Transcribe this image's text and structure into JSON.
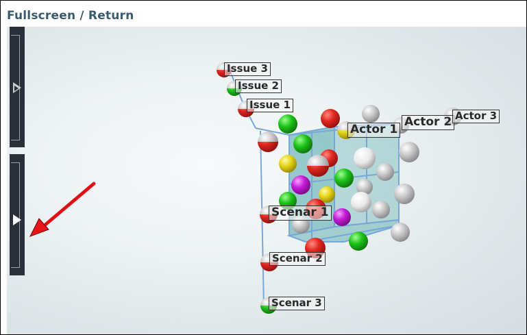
{
  "window": {
    "title": "Fullscreen / Return"
  },
  "sidebar": {
    "top_toggle_icon": "play-outline-icon",
    "bottom_toggle_icon": "play-solid-icon"
  },
  "annotation": {
    "icon": "red-arrow-icon",
    "color": "#e8141a"
  },
  "scene": {
    "issues": [
      {
        "label": "Issue 3"
      },
      {
        "label": "Issue 2"
      },
      {
        "label": "Issue 1"
      }
    ],
    "actors": [
      {
        "label": "Actor 1"
      },
      {
        "label": "Actor 2"
      },
      {
        "label": "Actor 3"
      }
    ],
    "scenarios": [
      {
        "label": "Scenar 1"
      },
      {
        "label": "Scenar 2"
      },
      {
        "label": "Scenar 3"
      }
    ],
    "colors": {
      "red": "#d9221e",
      "green": "#16c21a",
      "yellow": "#e6d416",
      "magenta": "#c41ad6",
      "grey": "#b9b9b9",
      "cube": "#3a9b9e"
    }
  }
}
